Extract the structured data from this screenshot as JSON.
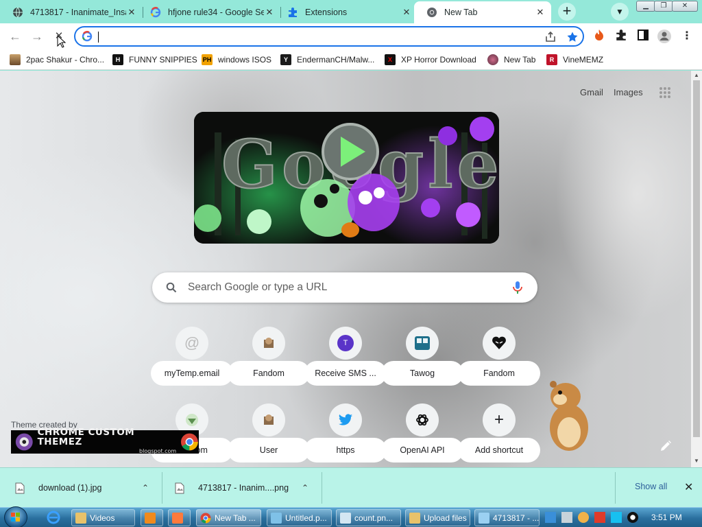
{
  "tabs": [
    {
      "title": "4713817 - Inanimate_Insa",
      "active": false
    },
    {
      "title": "hfjone rule34 - Google Se",
      "active": false
    },
    {
      "title": "Extensions",
      "active": false
    },
    {
      "title": "New Tab",
      "active": true
    }
  ],
  "toolbar": {
    "omnibox_value": "",
    "back_icon": "arrow-left-icon",
    "forward_icon": "arrow-right-icon",
    "stop_icon": "close-icon"
  },
  "bookmarks": [
    {
      "label": "2pac Shakur - Chro..."
    },
    {
      "label": "FUNNY SNIPPIES",
      "icon_text": "H"
    },
    {
      "label": "windows ISOS",
      "icon_text": "PH"
    },
    {
      "label": "EndermanCH/Malw...",
      "icon_text": "Y"
    },
    {
      "label": "XP Horror Download",
      "icon_text": "X"
    },
    {
      "label": "New Tab"
    },
    {
      "label": "VineMEMZ",
      "icon_text": "R"
    }
  ],
  "page": {
    "gmail_link": "Gmail",
    "images_link": "Images",
    "search_placeholder": "Search Google or type a URL",
    "doodle_text": "Google",
    "shortcuts_row1": [
      {
        "label": "myTemp.email",
        "icon_text": "@"
      },
      {
        "label": "Fandom"
      },
      {
        "label": "Receive SMS ...",
        "icon_text": "T"
      },
      {
        "label": "Tawog"
      },
      {
        "label": "Fandom"
      }
    ],
    "shortcuts_row2": [
      {
        "label": "Fandom"
      },
      {
        "label": "User"
      },
      {
        "label": "https"
      },
      {
        "label": "OpenAI API"
      },
      {
        "label": "Add shortcut",
        "icon_text": "+"
      }
    ],
    "theme_credit": "Theme created by",
    "theme_banner": "CHROME CUSTOM THEMEZ",
    "theme_banner_sub": "blogspot.com"
  },
  "downloads": [
    {
      "name": "download (1).jpg"
    },
    {
      "name": "4713817 - Inanim....png"
    }
  ],
  "downloads_show_all": "Show all",
  "taskbar": {
    "buttons": [
      {
        "label": "Videos",
        "active": false
      },
      {
        "label": "",
        "active": false
      },
      {
        "label": "",
        "active": false
      },
      {
        "label": "New Tab ...",
        "active": true
      },
      {
        "label": "Untitled.p...",
        "active": false
      },
      {
        "label": "count.pn...",
        "active": false
      },
      {
        "label": "Upload files",
        "active": false
      },
      {
        "label": "4713817 - ...",
        "active": false
      }
    ],
    "clock": "3:51 PM"
  },
  "colors": {
    "frame": "#94e8d9",
    "accent": "#1a73e8",
    "download_shelf": "#b9f3e8"
  }
}
